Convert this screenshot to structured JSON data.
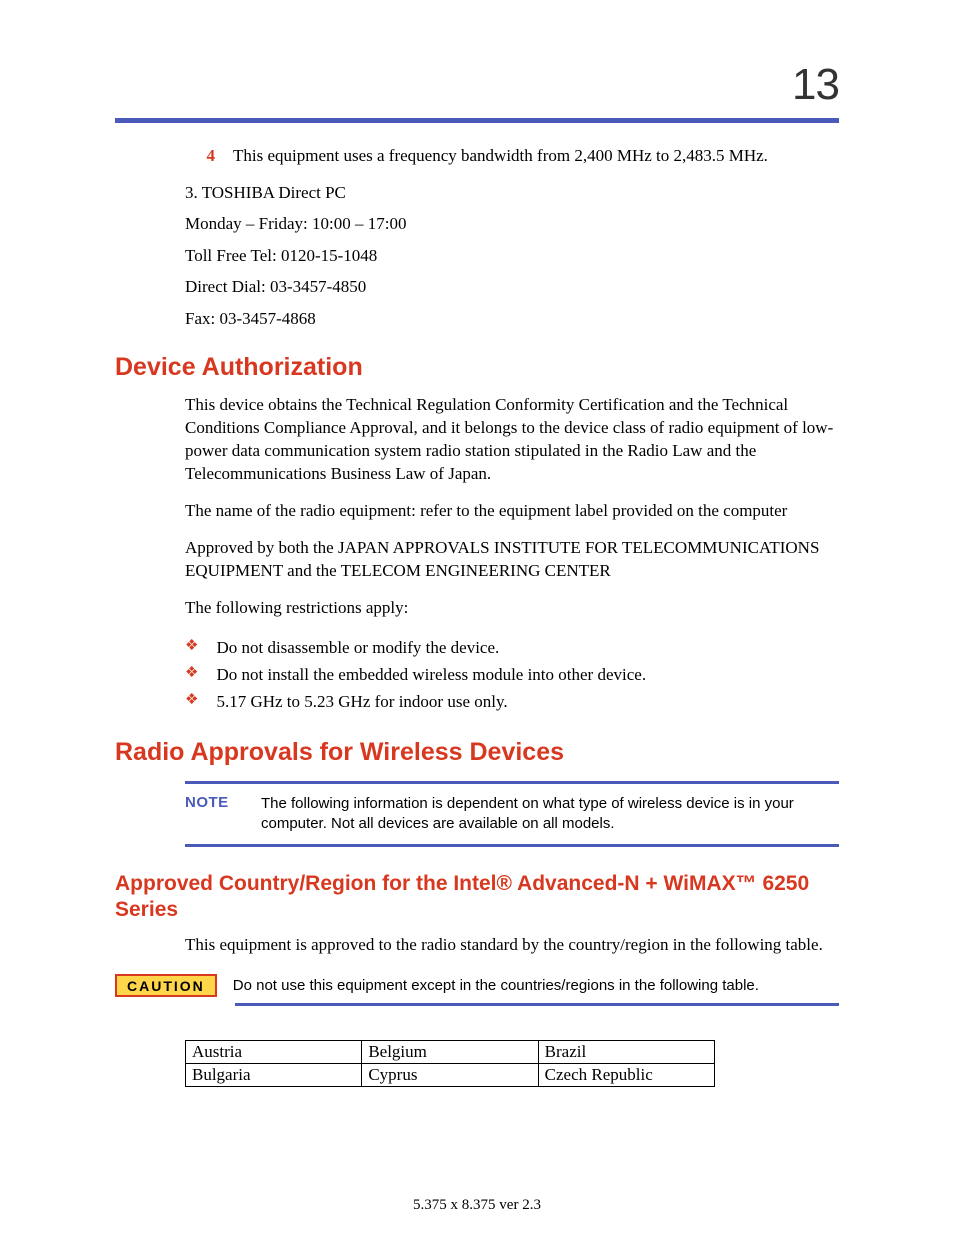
{
  "page_number": "13",
  "item4": {
    "num": "4",
    "text": "This equipment uses a frequency bandwidth from 2,400 MHz to 2,483.5 MHz."
  },
  "contact": {
    "line1": "3. TOSHIBA Direct PC",
    "line2": "Monday – Friday: 10:00 – 17:00",
    "line3": "Toll Free Tel: 0120-15-1048",
    "line4": "Direct Dial: 03-3457-4850",
    "line5": "Fax: 03-3457-4868"
  },
  "section1": {
    "title": "Device Authorization",
    "p1": "This device obtains the Technical Regulation Conformity Certification and the Technical Conditions Compliance Approval, and it belongs to the device class of radio equipment of low-power data communication system radio station stipulated in the Radio Law and the Telecommunications Business Law of Japan.",
    "p2": "The name of the radio equipment: refer to the equipment label provided on the computer",
    "p3": "Approved by both the JAPAN APPROVALS INSTITUTE FOR TELECOMMUNICATIONS EQUIPMENT and the TELECOM ENGINEERING CENTER",
    "p4": "The following restrictions apply:",
    "bullets": [
      "Do not disassemble or modify the device.",
      "Do not install the embedded wireless module into other device.",
      "5.17 GHz to 5.23 GHz for indoor use only."
    ]
  },
  "section2": {
    "title": "Radio Approvals for Wireless Devices",
    "note_label": "NOTE",
    "note_text": "The following information is dependent on what type of wireless device is in your computer. Not all devices are available on all models.",
    "subsection_title": "Approved Country/Region for the Intel® Advanced-N + WiMAX™ 6250 Series",
    "p1": "This equipment is approved to the radio standard by the country/region in the following table.",
    "caution_label": "CAUTION",
    "caution_text": "Do not use this equipment except in the countries/regions in the following table.",
    "table": [
      [
        "Austria",
        "Belgium",
        "Brazil"
      ],
      [
        "Bulgaria",
        "Cyprus",
        "Czech Republic"
      ]
    ]
  },
  "footer": "5.375 x 8.375 ver 2.3"
}
